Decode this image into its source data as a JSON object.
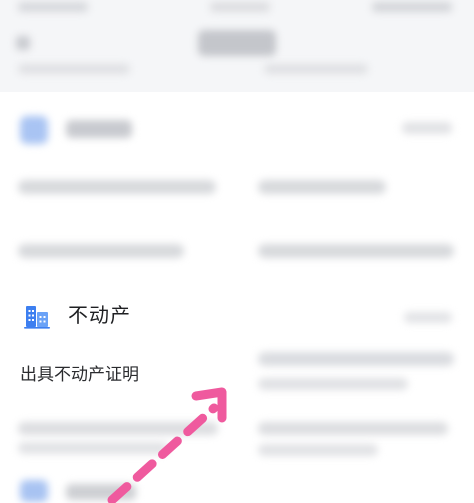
{
  "category": {
    "title": "不动产",
    "icon": "building-icon",
    "icon_color": "#3d7ff0"
  },
  "service_item": {
    "label": "出具不动产证明"
  },
  "annotation": {
    "arrow_color": "#ef5a9e",
    "style": "dashed-arrow-pointing-up-right"
  },
  "colors": {
    "background": "#f5f6f8",
    "card": "#ffffff",
    "blur_accent": "#a9c4f3"
  }
}
